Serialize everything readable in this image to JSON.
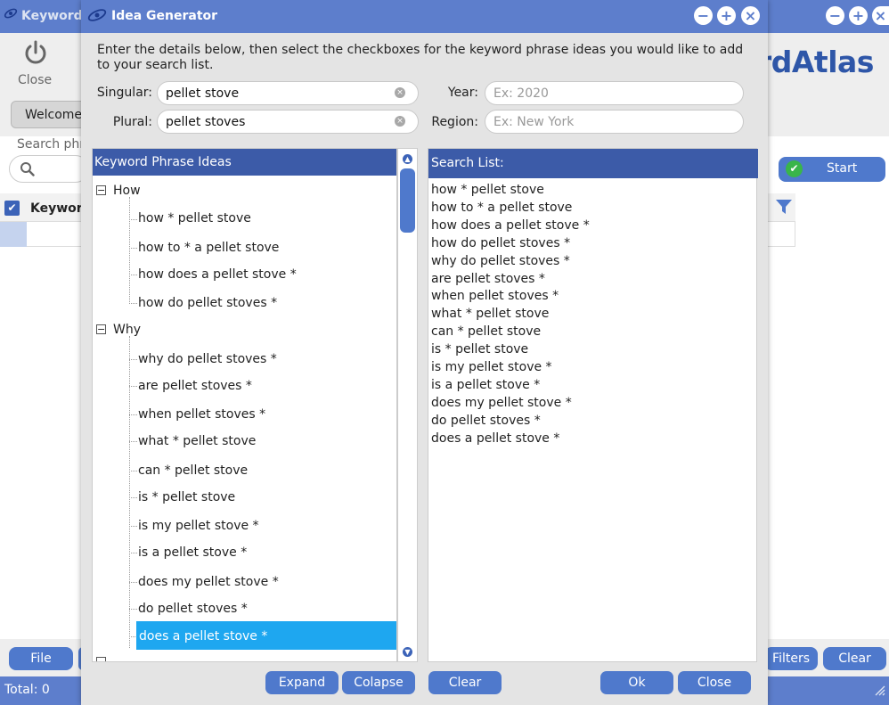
{
  "main_window": {
    "title": "Keyword",
    "close_label": "Close",
    "welcome_tab": "Welcome",
    "brand": "rdAtlas",
    "search_label": "Search phr",
    "start_label": "Start",
    "grid_column": "Keyword",
    "bottom_buttons": {
      "file": "File",
      "filters": "Filters",
      "clear": "Clear"
    },
    "total": "Total: 0"
  },
  "dialog": {
    "title": "Idea Generator",
    "instructions": "Enter the details below, then select the checkboxes for the keyword phrase ideas you would like to add to your search list.",
    "fields": {
      "singular": {
        "label": "Singular:",
        "value": "pellet stove"
      },
      "plural": {
        "label": "Plural:",
        "value": "pellet stoves"
      },
      "year": {
        "label": "Year:",
        "placeholder": "Ex: 2020"
      },
      "region": {
        "label": "Region:",
        "placeholder": "Ex: New York"
      }
    },
    "ideas_panel": {
      "header": "Keyword Phrase Ideas",
      "groups": [
        {
          "name": "How",
          "items": [
            "how * pellet stove",
            "how to * a pellet stove",
            "how does a pellet stove *",
            "how do pellet stoves *"
          ]
        },
        {
          "name": "Why",
          "items": [
            "why do pellet stoves *",
            "are pellet stoves *",
            "when pellet stoves *",
            "what * pellet stove",
            "can * pellet stove",
            "is * pellet stove",
            "is my pellet stove *",
            "is a pellet stove *",
            "does my pellet stove *",
            "do pellet stoves *",
            "does a pellet stove *"
          ]
        }
      ],
      "selected": "does a pellet stove *"
    },
    "search_panel": {
      "header": "Search List:",
      "items": [
        "how * pellet stove",
        "how to * a pellet stove",
        "how does a pellet stove *",
        "how do pellet stoves *",
        "why do pellet stoves *",
        "are pellet stoves *",
        "when pellet stoves *",
        "what * pellet stove",
        "can * pellet stove",
        "is * pellet stove",
        "is my pellet stove *",
        "is a pellet stove *",
        "does my pellet stove *",
        "do pellet stoves *",
        "does a pellet stove *"
      ]
    },
    "buttons": {
      "expand": "Expand",
      "collapse": "Colapse",
      "clear": "Clear",
      "ok": "Ok",
      "close": "Close"
    }
  },
  "colors": {
    "titlebar": "#5d7ecc",
    "panel_header": "#3c5ba8",
    "button": "#4f79cc",
    "selection": "#1ea7f0"
  }
}
